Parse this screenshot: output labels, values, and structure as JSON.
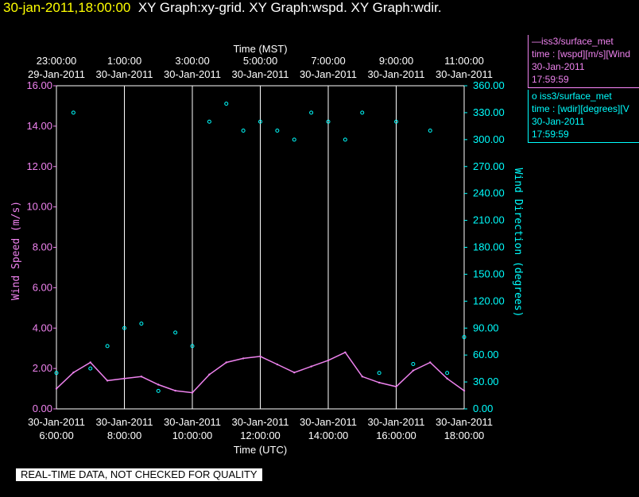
{
  "header": {
    "timestamp": "30-jan-2011,18:00:00",
    "titles": "XY Graph:xy-grid.  XY Graph:wspd.  XY Graph:wdir."
  },
  "legend": {
    "series1": {
      "name": "iss3/surface_met",
      "prefix": "—",
      "line2": "time : [wspd][m/s][Wind",
      "date": "30-Jan-2011",
      "time": "17:59:59"
    },
    "series2": {
      "name": "iss3/surface_met",
      "prefix": "o",
      "line2": "time : [wdir][degrees][V",
      "date": "30-Jan-2011",
      "time": "17:59:59"
    }
  },
  "footer": {
    "text": "REAL-TIME DATA, NOT CHECKED FOR QUALITY"
  },
  "colors": {
    "wspd": "#ee82ee",
    "wdir": "#00ffff",
    "grid": "#ffffff",
    "title": "#ffff00"
  },
  "chart_data": {
    "type": "line",
    "xlabel_top": "Time (MST)",
    "xlabel_bottom": "Time (UTC)",
    "ylabel_left": "Wind Speed (m/s)",
    "ylabel_right": "Wind Direction (degrees)",
    "xlim": [
      "2011-01-30T06:00",
      "2011-01-30T18:00"
    ],
    "ylim_left": [
      0,
      16
    ],
    "ylim_right": [
      0,
      360
    ],
    "grid": true,
    "x_ticks_bottom": [
      {
        "t": "2011-01-30T06:00",
        "date": "30-Jan-2011",
        "time": "6:00:00"
      },
      {
        "t": "2011-01-30T08:00",
        "date": "30-Jan-2011",
        "time": "8:00:00"
      },
      {
        "t": "2011-01-30T10:00",
        "date": "30-Jan-2011",
        "time": "10:00:00"
      },
      {
        "t": "2011-01-30T12:00",
        "date": "30-Jan-2011",
        "time": "12:00:00"
      },
      {
        "t": "2011-01-30T14:00",
        "date": "30-Jan-2011",
        "time": "14:00:00"
      },
      {
        "t": "2011-01-30T16:00",
        "date": "30-Jan-2011",
        "time": "16:00:00"
      },
      {
        "t": "2011-01-30T18:00",
        "date": "30-Jan-2011",
        "time": "18:00:00"
      }
    ],
    "x_ticks_top": [
      {
        "t": "2011-01-30T06:00",
        "time": "23:00:00",
        "date": "29-Jan-2011"
      },
      {
        "t": "2011-01-30T08:00",
        "time": "1:00:00",
        "date": "30-Jan-2011"
      },
      {
        "t": "2011-01-30T10:00",
        "time": "3:00:00",
        "date": "30-Jan-2011"
      },
      {
        "t": "2011-01-30T12:00",
        "time": "5:00:00",
        "date": "30-Jan-2011"
      },
      {
        "t": "2011-01-30T14:00",
        "time": "7:00:00",
        "date": "30-Jan-2011"
      },
      {
        "t": "2011-01-30T16:00",
        "time": "9:00:00",
        "date": "30-Jan-2011"
      },
      {
        "t": "2011-01-30T18:00",
        "time": "11:00:00",
        "date": "30-Jan-2011"
      }
    ],
    "y_ticks_left": [
      "0.00",
      "2.00",
      "4.00",
      "6.00",
      "8.00",
      "10.00",
      "12.00",
      "14.00",
      "16.00"
    ],
    "y_ticks_right": [
      "0.00",
      "30.00",
      "60.00",
      "90.00",
      "120.00",
      "150.00",
      "180.00",
      "210.00",
      "240.00",
      "270.00",
      "300.00",
      "330.00",
      "360.00"
    ],
    "series": [
      {
        "name": "wspd",
        "x": [
          "2011-01-30T06:00",
          "2011-01-30T06:30",
          "2011-01-30T07:00",
          "2011-01-30T07:30",
          "2011-01-30T08:00",
          "2011-01-30T08:30",
          "2011-01-30T09:00",
          "2011-01-30T09:30",
          "2011-01-30T10:00",
          "2011-01-30T10:30",
          "2011-01-30T11:00",
          "2011-01-30T11:30",
          "2011-01-30T12:00",
          "2011-01-30T12:30",
          "2011-01-30T13:00",
          "2011-01-30T13:30",
          "2011-01-30T14:00",
          "2011-01-30T14:30",
          "2011-01-30T15:00",
          "2011-01-30T15:30",
          "2011-01-30T16:00",
          "2011-01-30T16:30",
          "2011-01-30T17:00",
          "2011-01-30T17:30",
          "2011-01-30T18:00"
        ],
        "y": [
          1.0,
          1.8,
          2.3,
          1.4,
          1.5,
          1.6,
          1.2,
          0.9,
          0.8,
          1.7,
          2.3,
          2.5,
          2.6,
          2.2,
          1.8,
          2.1,
          2.4,
          2.8,
          1.6,
          1.3,
          1.1,
          1.9,
          2.3,
          1.5,
          0.9
        ]
      },
      {
        "name": "wdir",
        "x": [
          "2011-01-30T06:00",
          "2011-01-30T06:30",
          "2011-01-30T07:00",
          "2011-01-30T07:30",
          "2011-01-30T08:00",
          "2011-01-30T08:30",
          "2011-01-30T09:00",
          "2011-01-30T09:30",
          "2011-01-30T10:00",
          "2011-01-30T10:30",
          "2011-01-30T11:00",
          "2011-01-30T11:30",
          "2011-01-30T12:00",
          "2011-01-30T12:30",
          "2011-01-30T13:00",
          "2011-01-30T13:30",
          "2011-01-30T14:00",
          "2011-01-30T14:30",
          "2011-01-30T15:00",
          "2011-01-30T15:30",
          "2011-01-30T16:00",
          "2011-01-30T16:30",
          "2011-01-30T17:00",
          "2011-01-30T17:30",
          "2011-01-30T18:00"
        ],
        "y": [
          40,
          330,
          45,
          70,
          90,
          95,
          20,
          85,
          70,
          320,
          340,
          310,
          320,
          310,
          300,
          330,
          320,
          300,
          330,
          40,
          320,
          50,
          310,
          40,
          80
        ]
      }
    ]
  }
}
